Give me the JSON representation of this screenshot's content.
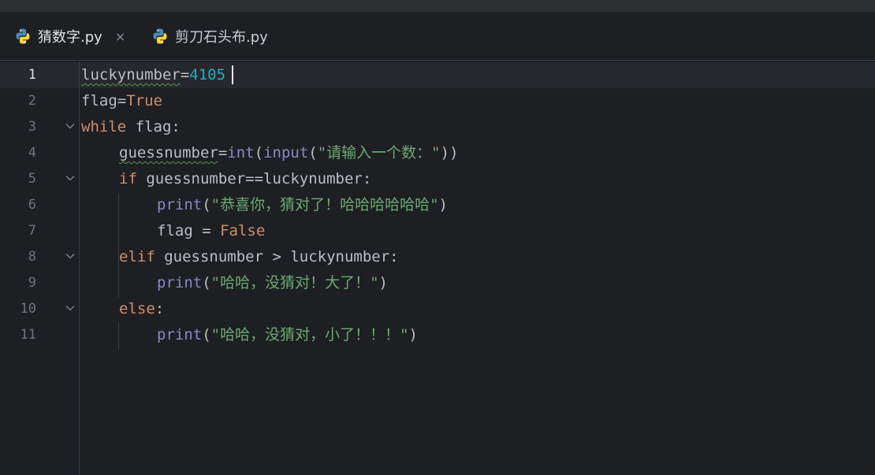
{
  "tabs": [
    {
      "label": "猜数字.py",
      "active": true,
      "icon": "python-icon",
      "close": "×"
    },
    {
      "label": "剪刀石头布.py",
      "active": false,
      "icon": "python-icon"
    }
  ],
  "colors": {
    "background": "#1e1f22",
    "keyword": "#cf8e6d",
    "builtin": "#8888c6",
    "number": "#2aacb8",
    "string": "#6aab73",
    "accent": "#3574f0"
  },
  "code": {
    "lines": [
      {
        "n": "1",
        "tokens": [
          {
            "t": "luckynumber",
            "c": "plain",
            "w": true
          },
          {
            "t": "=",
            "c": "plain"
          },
          {
            "t": "4105",
            "c": "num"
          }
        ]
      },
      {
        "n": "2",
        "tokens": [
          {
            "t": "flag",
            "c": "plain"
          },
          {
            "t": "=",
            "c": "plain"
          },
          {
            "t": "True",
            "c": "kw"
          }
        ]
      },
      {
        "n": "3",
        "tokens": [
          {
            "t": "while",
            "c": "kw"
          },
          {
            "t": " flag:",
            "c": "plain"
          }
        ]
      },
      {
        "n": "4",
        "tokens": [
          {
            "t": "guessnumber",
            "c": "plain",
            "w": true
          },
          {
            "t": "=",
            "c": "plain"
          },
          {
            "t": "int",
            "c": "fn"
          },
          {
            "t": "(",
            "c": "plain"
          },
          {
            "t": "input",
            "c": "fn"
          },
          {
            "t": "(",
            "c": "plain"
          },
          {
            "t": "\"请输入一个数：\"",
            "c": "str"
          },
          {
            "t": "))",
            "c": "plain"
          }
        ]
      },
      {
        "n": "5",
        "tokens": [
          {
            "t": "if",
            "c": "kw"
          },
          {
            "t": " guessnumber==luckynumber:",
            "c": "plain"
          }
        ]
      },
      {
        "n": "6",
        "tokens": [
          {
            "t": "print",
            "c": "fn"
          },
          {
            "t": "(",
            "c": "plain"
          },
          {
            "t": "\"恭喜你，猜对了！哈哈哈哈哈哈\"",
            "c": "str"
          },
          {
            "t": ")",
            "c": "plain"
          }
        ]
      },
      {
        "n": "7",
        "tokens": [
          {
            "t": "flag = ",
            "c": "plain"
          },
          {
            "t": "False",
            "c": "kw"
          }
        ]
      },
      {
        "n": "8",
        "tokens": [
          {
            "t": "elif",
            "c": "kw"
          },
          {
            "t": " guessnumber > luckynumber:",
            "c": "plain"
          }
        ]
      },
      {
        "n": "9",
        "tokens": [
          {
            "t": "print",
            "c": "fn"
          },
          {
            "t": "(",
            "c": "plain"
          },
          {
            "t": "\"哈哈，没猜对！大了！\"",
            "c": "str"
          },
          {
            "t": ")",
            "c": "plain"
          }
        ]
      },
      {
        "n": "10",
        "tokens": [
          {
            "t": "else",
            "c": "kw"
          },
          {
            "t": ":",
            "c": "plain"
          }
        ]
      },
      {
        "n": "11",
        "tokens": [
          {
            "t": "print",
            "c": "fn"
          },
          {
            "t": "(",
            "c": "plain"
          },
          {
            "t": "\"哈哈，没猜对，小了！！！\"",
            "c": "str"
          },
          {
            "t": ")",
            "c": "plain"
          }
        ]
      }
    ]
  }
}
